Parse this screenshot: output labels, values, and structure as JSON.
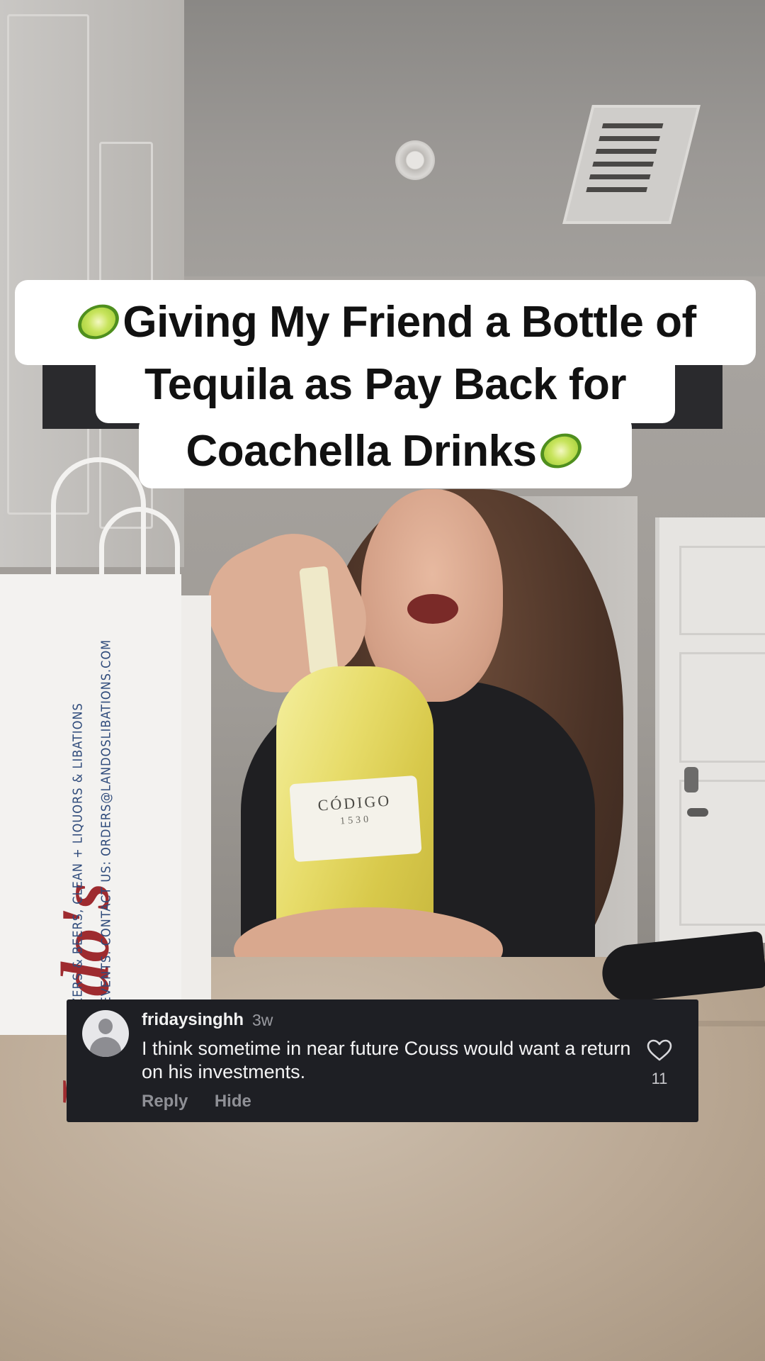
{
  "caption": {
    "line1": "Giving My Friend a Bottle of",
    "line2": "Tequila as Pay Back for",
    "line3": "Coachella Drinks",
    "emoji_icon": "lime-icon"
  },
  "scene": {
    "bottle_brand": "CÓDIGO",
    "bottle_year": "1530",
    "bag_logo": "Lando's",
    "bag_line1": "WINES, SELTZERS & BEERS, CLEAN + LIQUORS & LIBATIONS",
    "bag_line2": "ARE EXPERTS AT EVENTS. CONTACT US: ORDERS@LANDOSLIBATIONS.COM"
  },
  "comment": {
    "username": "fridaysinghh",
    "time": "3w",
    "text": "I think sometime in near future Couss would want a return on his investments.",
    "reply_label": "Reply",
    "hide_label": "Hide",
    "like_count": "11",
    "avatar_icon": "default-avatar-icon",
    "like_icon": "heart-outline-icon"
  },
  "colors": {
    "caption_bg": "#ffffff",
    "caption_text": "#111111",
    "comment_bg": "#1e1f24",
    "comment_muted": "#8f9096"
  }
}
